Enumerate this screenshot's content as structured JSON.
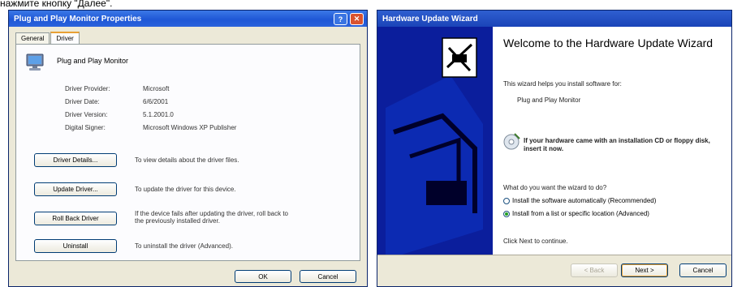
{
  "caption": "нажмите кнопку \"Далее\".",
  "left_window": {
    "title": "Plug and Play Monitor Properties",
    "help_label": "?",
    "close_label": "✕",
    "tabs": [
      {
        "label": "General"
      },
      {
        "label": "Driver"
      }
    ],
    "device_name": "Plug and Play Monitor",
    "properties": [
      {
        "label": "Driver Provider:",
        "value": "Microsoft"
      },
      {
        "label": "Driver Date:",
        "value": "6/6/2001"
      },
      {
        "label": "Driver Version:",
        "value": "5.1.2001.0"
      },
      {
        "label": "Digital Signer:",
        "value": "Microsoft Windows XP Publisher"
      }
    ],
    "buttons": [
      {
        "label": "Driver Details...",
        "desc": "To view details about the driver files."
      },
      {
        "label": "Update Driver...",
        "desc": "To update the driver for this device."
      },
      {
        "label": "Roll Back Driver",
        "desc": "If the device fails after updating the driver, roll back to the previously installed driver."
      },
      {
        "label": "Uninstall",
        "desc": "To uninstall the driver (Advanced)."
      }
    ],
    "ok_label": "OK",
    "cancel_label": "Cancel"
  },
  "right_window": {
    "title": "Hardware Update Wizard",
    "heading": "Welcome to the Hardware Update Wizard",
    "intro": "This wizard helps you install software for:",
    "device": "Plug and Play Monitor",
    "cd_hint": "If your hardware came with an installation CD or floppy disk, insert it now.",
    "question": "What do you want the wizard to do?",
    "options": [
      {
        "label": "Install the software automatically (Recommended)",
        "selected": false
      },
      {
        "label": "Install from a list or specific location (Advanced)",
        "selected": true
      }
    ],
    "continue_text": "Click Next to continue.",
    "back_label": "< Back",
    "next_label": "Next >",
    "cancel_label": "Cancel"
  }
}
